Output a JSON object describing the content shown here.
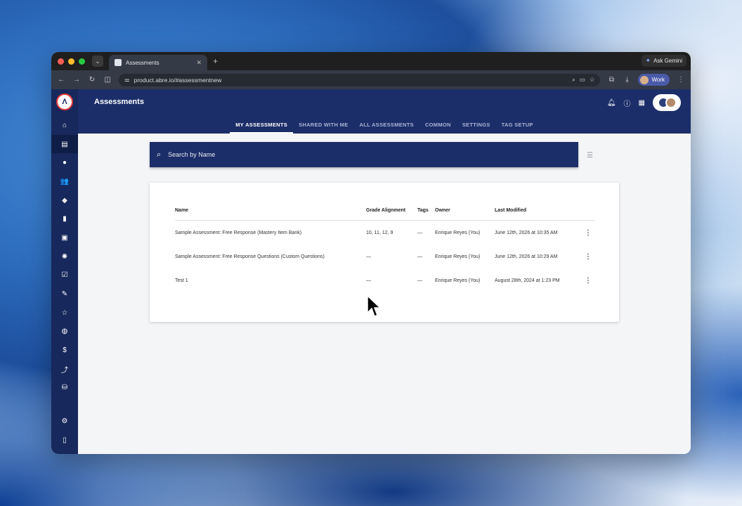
{
  "browser": {
    "tab_title": "Assessments",
    "url": "product.abre.io/#assessmentnew",
    "ask_gemini": "Ask Gemini",
    "profile_label": "Work"
  },
  "app": {
    "title": "Assessments",
    "tabs": [
      {
        "label": "MY ASSESSMENTS",
        "active": true
      },
      {
        "label": "SHARED WITH ME",
        "active": false
      },
      {
        "label": "ALL ASSESSMENTS",
        "active": false
      },
      {
        "label": "COMMON",
        "active": false
      },
      {
        "label": "SETTINGS",
        "active": false
      },
      {
        "label": "TAG SETUP",
        "active": false
      }
    ],
    "search": {
      "placeholder": "Search by Name"
    }
  },
  "table": {
    "headers": {
      "name": "Name",
      "grade": "Grade Alignment",
      "tags": "Tags",
      "owner": "Owner",
      "modified": "Last Modified"
    },
    "rows": [
      {
        "name": "Sample Assessment: Free Response (Mastery Item Bank)",
        "grade": "10, 11, 12, 9",
        "tags": "—",
        "owner": "Enrique Reyes (You)",
        "modified": "June 12th, 2026 at 10:35 AM"
      },
      {
        "name": "Sample Assessment: Free Response Questions (Custom Questions)",
        "grade": "—",
        "tags": "—",
        "owner": "Enrique Reyes (You)",
        "modified": "June 12th, 2026 at 10:29 AM"
      },
      {
        "name": "Test 1",
        "grade": "—",
        "tags": "—",
        "owner": "Enrique Reyes (You)",
        "modified": "August 28th, 2024 at 1:23 PM"
      }
    ]
  },
  "icons": {
    "sidebar": [
      "home-icon",
      "dashboard-icon",
      "account-icon",
      "people-icon",
      "directions-icon",
      "book-icon",
      "clipboard-icon",
      "lightbulb-icon",
      "checklist-icon",
      "person-edit-icon",
      "star-icon",
      "globe-icon",
      "dollar-icon",
      "trend-icon",
      "database-settings-icon",
      "gear-icon",
      "mobile-icon"
    ]
  }
}
